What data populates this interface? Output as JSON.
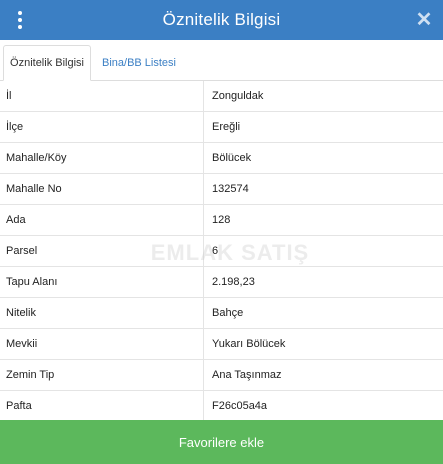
{
  "header": {
    "title": "Öznitelik Bilgisi",
    "menu_icon": "vertical-ellipsis-icon",
    "close_icon": "close-icon",
    "close_glyph": "✕",
    "color": "#3b7fc4"
  },
  "tabs": [
    {
      "label": "Öznitelik Bilgisi",
      "active": true
    },
    {
      "label": "Bina/BB Listesi",
      "active": false
    }
  ],
  "rows": [
    {
      "label": "İl",
      "value": "Zonguldak"
    },
    {
      "label": "İlçe",
      "value": "Ereğli"
    },
    {
      "label": "Mahalle/Köy",
      "value": "Bölücek"
    },
    {
      "label": "Mahalle No",
      "value": "132574"
    },
    {
      "label": "Ada",
      "value": "128"
    },
    {
      "label": "Parsel",
      "value": "6"
    },
    {
      "label": "Tapu Alanı",
      "value": "2.198,23"
    },
    {
      "label": "Nitelik",
      "value": "Bahçe"
    },
    {
      "label": "Mevkii",
      "value": "Yukarı Bölücek"
    },
    {
      "label": "Zemin Tip",
      "value": "Ana Taşınmaz"
    },
    {
      "label": "Pafta",
      "value": "F26c05a4a"
    }
  ],
  "watermark": "EMLAK SATIŞ",
  "footer": {
    "button_label": "Favorilere ekle",
    "color": "#5cb85c"
  }
}
